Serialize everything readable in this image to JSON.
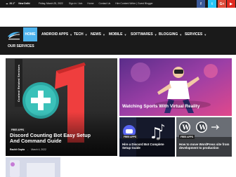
{
  "topbar": {
    "temperature": "26.1°",
    "weather_icon": "cloud-icon",
    "city": "New Delhi",
    "date": "Friday, March 25, 2022",
    "links": [
      "Sign in / Join",
      "Home",
      "Contact Us",
      "Hire Content Writer | Guest Blogger"
    ],
    "social": [
      "f",
      "t",
      "G+",
      "▶"
    ]
  },
  "nav": {
    "home": "HOME",
    "items": [
      "ANDROID APPS",
      "TECH",
      "NEWS",
      "MOBILE",
      "SOFTWARES",
      "BLOGGING",
      "SERVICES"
    ],
    "row2": "OUR SERVICES"
  },
  "main_post": {
    "vertical_tag": "Content Related Services",
    "category": "FREE APPS",
    "title": "Discord Counting Bot Easy Setup And Command Guide",
    "author": "Rachit Gupta",
    "date": "March 4, 2022"
  },
  "side_post": {
    "title": "Watching Sports With Virtual Reality"
  },
  "small_posts": [
    {
      "category": "FREE APPS",
      "title": "Hire a Discord Bot Complete Setup Guide"
    },
    {
      "category": "FREE APPS",
      "title": "How to move WordPress site from development to production"
    }
  ],
  "colors": {
    "accent": "#4db2ec",
    "nav_bg": "#1a1a1a",
    "topbar_bg": "#191919",
    "discord_red": "#ef3e3e",
    "facebook": "#3b5998",
    "twitter": "#29c5f6",
    "google": "#dd4b39",
    "youtube": "#e02a20"
  }
}
